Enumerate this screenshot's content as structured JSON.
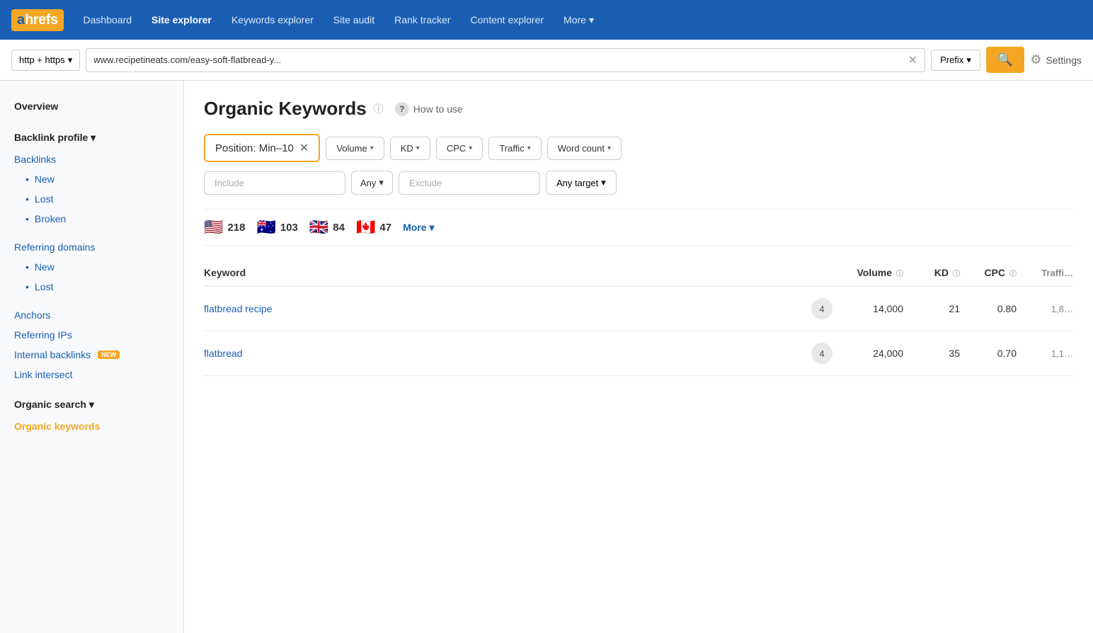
{
  "nav": {
    "logo_a": "a",
    "logo_rest": "hrefs",
    "links": [
      {
        "label": "Dashboard",
        "active": false
      },
      {
        "label": "Site explorer",
        "active": true
      },
      {
        "label": "Keywords explorer",
        "active": false
      },
      {
        "label": "Site audit",
        "active": false
      },
      {
        "label": "Rank tracker",
        "active": false
      },
      {
        "label": "Content explorer",
        "active": false
      }
    ],
    "more_label": "More"
  },
  "searchbar": {
    "protocol": "http + https",
    "url": "www.recipetineats.com/easy-soft-flatbread-y...",
    "mode": "Prefix",
    "settings_label": "Settings"
  },
  "sidebar": {
    "overview_label": "Overview",
    "backlink_profile_label": "Backlink profile",
    "backlinks_label": "Backlinks",
    "backlinks_new": "New",
    "backlinks_lost": "Lost",
    "backlinks_broken": "Broken",
    "referring_domains_label": "Referring domains",
    "referring_domains_new": "New",
    "referring_domains_lost": "Lost",
    "anchors_label": "Anchors",
    "referring_ips_label": "Referring IPs",
    "internal_backlinks_label": "Internal backlinks",
    "internal_backlinks_badge": "NEW",
    "link_intersect_label": "Link intersect",
    "organic_search_label": "Organic search",
    "organic_keywords_label": "Organic keywords"
  },
  "content": {
    "page_title": "Organic Keywords",
    "how_to_use": "How to use",
    "position_filter_label": "Position: Min–10",
    "volume_filter": "Volume",
    "kd_filter": "KD",
    "cpc_filter": "CPC",
    "traffic_filter": "Traffic",
    "word_count_filter": "Word count",
    "include_placeholder": "Include",
    "any_label": "Any",
    "exclude_placeholder": "Exclude",
    "any_target_label": "Any target",
    "countries": [
      {
        "flag": "🇺🇸",
        "count": "218"
      },
      {
        "flag": "🇦🇺",
        "count": "103"
      },
      {
        "flag": "🇬🇧",
        "count": "84"
      },
      {
        "flag": "🇨🇦",
        "count": "47"
      }
    ],
    "more_countries": "More",
    "table_headers": [
      {
        "label": "Keyword",
        "info": false
      },
      {
        "label": "",
        "info": false
      },
      {
        "label": "Volume",
        "info": true
      },
      {
        "label": "KD",
        "info": true
      },
      {
        "label": "CPC",
        "info": true
      },
      {
        "label": "Traffi…",
        "info": false
      }
    ],
    "rows": [
      {
        "keyword": "flatbread recipe",
        "position": "4",
        "volume": "14,000",
        "kd": "21",
        "cpc": "0.80",
        "traffic": "1,8…"
      },
      {
        "keyword": "flatbread",
        "position": "4",
        "volume": "24,000",
        "kd": "35",
        "cpc": "0.70",
        "traffic": "1,1…"
      }
    ]
  }
}
